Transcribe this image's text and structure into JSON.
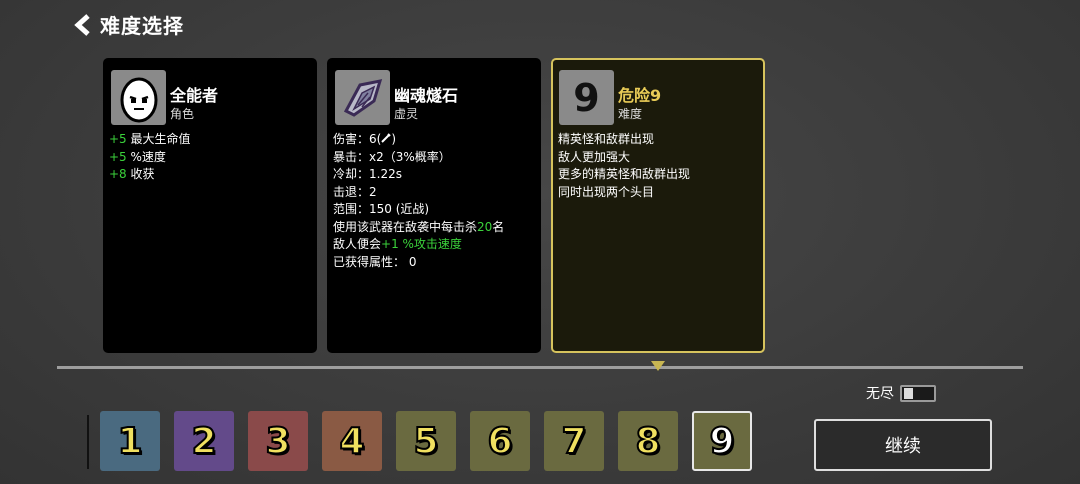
{
  "header": {
    "title": "难度选择",
    "back_icon": "chevron-left-icon"
  },
  "cards": [
    {
      "name": "全能者",
      "sub": "角色",
      "icon": "egg-character-icon",
      "lines": [
        {
          "value": "+5",
          "text": "最大生命值"
        },
        {
          "value": "+5",
          "text": "%速度"
        },
        {
          "value": "+8",
          "text": "收获"
        }
      ]
    },
    {
      "name": "幽魂燧石",
      "sub": "虚灵",
      "icon": "flint-stone-icon",
      "lines": [
        "伤害：6(",
        ")",
        "暴击：x2（3%概率）",
        "冷却：1.22s",
        "击退：2",
        "范围：150 (近战)",
        "使用该武器在敌袭中每击杀",
        "20",
        "名",
        "敌人便会",
        "+1 %攻击速度",
        "已获得属性： 0"
      ]
    },
    {
      "name": "危险9",
      "sub": "难度",
      "icon_label": "9",
      "lines": [
        "精英怪和敌群出现",
        "敌人更加强大",
        "更多的精英怪和敌群出现",
        "同时出现两个头目"
      ]
    }
  ],
  "endless": {
    "label": "无尽",
    "on": false
  },
  "difficulties": [
    {
      "label": "1",
      "color": "#4a6a80"
    },
    {
      "label": "2",
      "color": "#634a8a"
    },
    {
      "label": "3",
      "color": "#8a4a4a"
    },
    {
      "label": "4",
      "color": "#8a5a44"
    },
    {
      "label": "5",
      "color": "#6a6a40"
    },
    {
      "label": "6",
      "color": "#6a6a40"
    },
    {
      "label": "7",
      "color": "#6a6a40"
    },
    {
      "label": "8",
      "color": "#6a6a40"
    },
    {
      "label": "9",
      "color": "#6a6a40",
      "selected": true
    }
  ],
  "continue_label": "继续"
}
